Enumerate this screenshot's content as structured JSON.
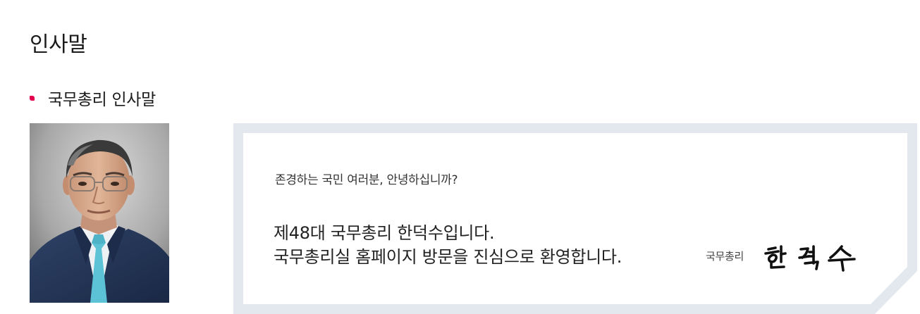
{
  "page": {
    "title": "인사말"
  },
  "section": {
    "title": "국무총리 인사말"
  },
  "portrait": {
    "alt": "국무총리"
  },
  "message": {
    "greeting": "존경하는 국민 여러분, 안녕하십니까?",
    "line1": "제48대 국무총리 한덕수입니다.",
    "line2": "국무총리실 홈페이지 방문을 진심으로 환영합니다."
  },
  "signature": {
    "label": "국무총리",
    "name": "한덕수"
  },
  "colors": {
    "accent": "#e5004f",
    "frame": "#e3e8ee",
    "suit": "#243555",
    "tie": "#5cc3d6"
  }
}
